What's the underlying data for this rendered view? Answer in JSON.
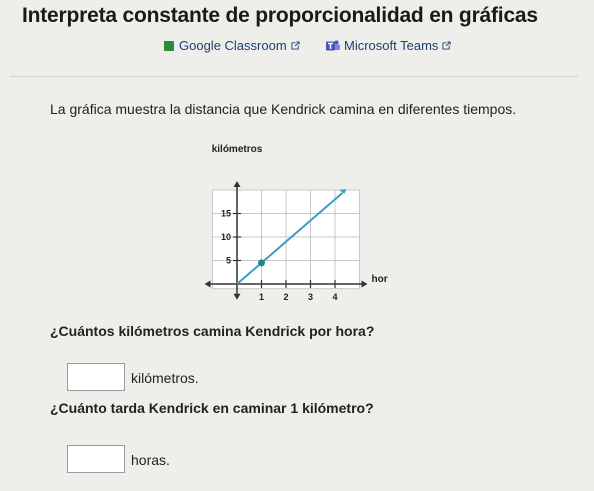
{
  "page": {
    "title": "Interpreta constante de proporcionalidad en gráficas"
  },
  "links": {
    "classroom": {
      "label": "Google Classroom",
      "icon": "google-classroom-icon",
      "color": "#2d8a3a"
    },
    "teams": {
      "label": "Microsoft Teams",
      "icon": "microsoft-teams-icon",
      "color": "#4b53bc"
    }
  },
  "intro_text": "La gráfica muestra la distancia que Kendrick camina en diferentes tiempos.",
  "chart_data": {
    "type": "line",
    "ylabel": "kilómetros",
    "xlabel": "horas",
    "x_ticks": [
      "1",
      "2",
      "3",
      "4"
    ],
    "y_ticks": [
      "5",
      "10",
      "15"
    ],
    "xlim": [
      -1,
      5
    ],
    "ylim": [
      -1,
      20
    ],
    "grid": true,
    "line_color": "#3b9cc4",
    "point_color": "#1e8a8a",
    "series": [
      {
        "x": [
          0,
          4.3
        ],
        "y": [
          0,
          19.35
        ]
      }
    ],
    "highlighted_point": {
      "x": 1,
      "y": 4.5
    }
  },
  "questions": [
    {
      "text": "¿Cuántos kilómetros camina Kendrick por hora?",
      "answer_value": "",
      "unit": "kilómetros."
    },
    {
      "text": "¿Cuánto tarda Kendrick en caminar 1 kilómetro?",
      "answer_value": "",
      "unit": "horas."
    }
  ]
}
